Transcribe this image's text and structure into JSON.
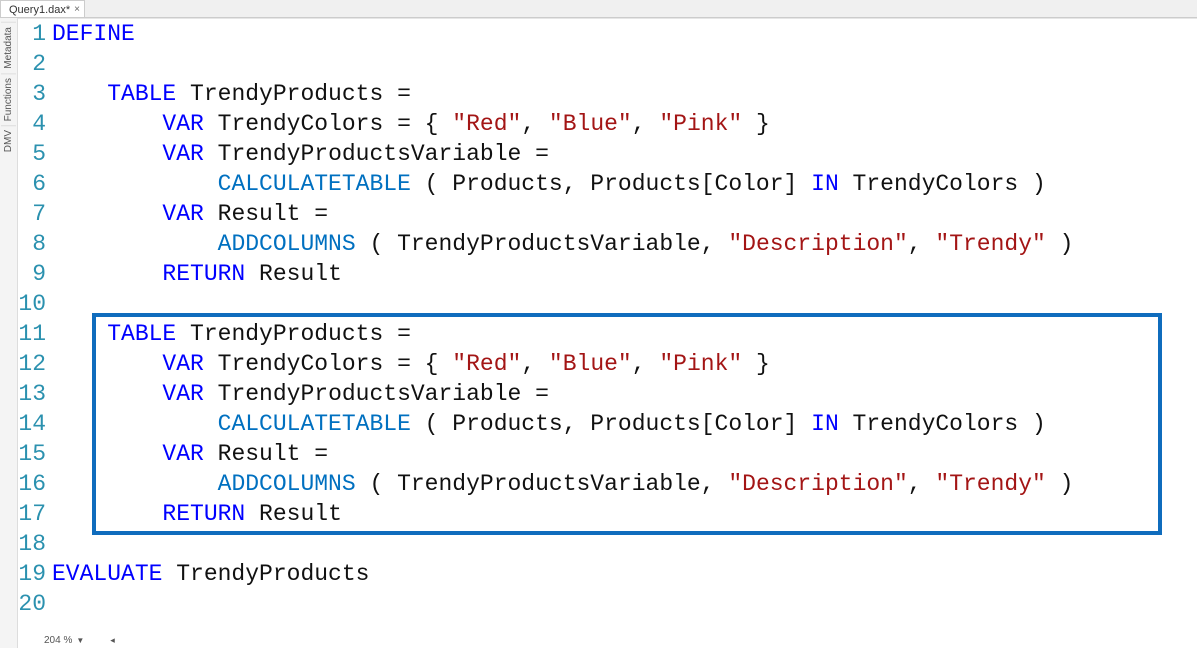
{
  "tab": {
    "label": "Query1.dax*",
    "closeGlyph": "×"
  },
  "sideTabs": [
    "Metadata",
    "Functions",
    "DMV"
  ],
  "status": {
    "zoom": "204 %"
  },
  "lineCount": 20,
  "highlight": {
    "fromLine": 11,
    "toLine": 17
  },
  "code": {
    "l1": [
      {
        "t": "DEFINE",
        "c": "kw"
      }
    ],
    "l2": [],
    "l3": [
      {
        "t": "    ",
        "c": ""
      },
      {
        "t": "TABLE",
        "c": "kw"
      },
      {
        "t": " TrendyProducts = ",
        "c": ""
      }
    ],
    "l4": [
      {
        "t": "        ",
        "c": ""
      },
      {
        "t": "VAR",
        "c": "kw"
      },
      {
        "t": " TrendyColors = { ",
        "c": ""
      },
      {
        "t": "\"Red\"",
        "c": "str"
      },
      {
        "t": ", ",
        "c": ""
      },
      {
        "t": "\"Blue\"",
        "c": "str"
      },
      {
        "t": ", ",
        "c": ""
      },
      {
        "t": "\"Pink\"",
        "c": "str"
      },
      {
        "t": " }",
        "c": ""
      }
    ],
    "l5": [
      {
        "t": "        ",
        "c": ""
      },
      {
        "t": "VAR",
        "c": "kw"
      },
      {
        "t": " TrendyProductsVariable = ",
        "c": ""
      }
    ],
    "l6": [
      {
        "t": "            ",
        "c": ""
      },
      {
        "t": "CALCULATETABLE",
        "c": "fn"
      },
      {
        "t": " ( Products, Products[Color] ",
        "c": ""
      },
      {
        "t": "IN",
        "c": "kw"
      },
      {
        "t": " TrendyColors )",
        "c": ""
      }
    ],
    "l7": [
      {
        "t": "        ",
        "c": ""
      },
      {
        "t": "VAR",
        "c": "kw"
      },
      {
        "t": " Result = ",
        "c": ""
      }
    ],
    "l8": [
      {
        "t": "            ",
        "c": ""
      },
      {
        "t": "ADDCOLUMNS",
        "c": "fn"
      },
      {
        "t": " ( TrendyProductsVariable, ",
        "c": ""
      },
      {
        "t": "\"Description\"",
        "c": "str"
      },
      {
        "t": ", ",
        "c": ""
      },
      {
        "t": "\"Trendy\"",
        "c": "str"
      },
      {
        "t": " )",
        "c": ""
      }
    ],
    "l9": [
      {
        "t": "        ",
        "c": ""
      },
      {
        "t": "RETURN",
        "c": "kw"
      },
      {
        "t": " Result",
        "c": ""
      }
    ],
    "l10": [],
    "l11": [
      {
        "t": "    ",
        "c": ""
      },
      {
        "t": "TABLE",
        "c": "kw"
      },
      {
        "t": " TrendyProducts = ",
        "c": ""
      }
    ],
    "l12": [
      {
        "t": "        ",
        "c": ""
      },
      {
        "t": "VAR",
        "c": "kw"
      },
      {
        "t": " TrendyColors = { ",
        "c": ""
      },
      {
        "t": "\"Red\"",
        "c": "str"
      },
      {
        "t": ", ",
        "c": ""
      },
      {
        "t": "\"Blue\"",
        "c": "str"
      },
      {
        "t": ", ",
        "c": ""
      },
      {
        "t": "\"Pink\"",
        "c": "str"
      },
      {
        "t": " }",
        "c": ""
      }
    ],
    "l13": [
      {
        "t": "        ",
        "c": ""
      },
      {
        "t": "VAR",
        "c": "kw"
      },
      {
        "t": " TrendyProductsVariable = ",
        "c": ""
      }
    ],
    "l14": [
      {
        "t": "            ",
        "c": ""
      },
      {
        "t": "CALCULATETABLE",
        "c": "fn"
      },
      {
        "t": " ( Products, Products[Color] ",
        "c": ""
      },
      {
        "t": "IN",
        "c": "kw"
      },
      {
        "t": " TrendyColors )",
        "c": ""
      }
    ],
    "l15": [
      {
        "t": "        ",
        "c": ""
      },
      {
        "t": "VAR",
        "c": "kw"
      },
      {
        "t": " Result = ",
        "c": ""
      }
    ],
    "l16": [
      {
        "t": "            ",
        "c": ""
      },
      {
        "t": "ADDCOLUMNS",
        "c": "fn"
      },
      {
        "t": " ( TrendyProductsVariable, ",
        "c": ""
      },
      {
        "t": "\"Description\"",
        "c": "str"
      },
      {
        "t": ", ",
        "c": ""
      },
      {
        "t": "\"Trendy\"",
        "c": "str"
      },
      {
        "t": " )",
        "c": ""
      }
    ],
    "l17": [
      {
        "t": "        ",
        "c": ""
      },
      {
        "t": "RETURN",
        "c": "kw"
      },
      {
        "t": " Result",
        "c": ""
      }
    ],
    "l18": [],
    "l19": [
      {
        "t": "EVALUATE",
        "c": "kw"
      },
      {
        "t": " TrendyProducts",
        "c": ""
      }
    ],
    "l20": []
  }
}
